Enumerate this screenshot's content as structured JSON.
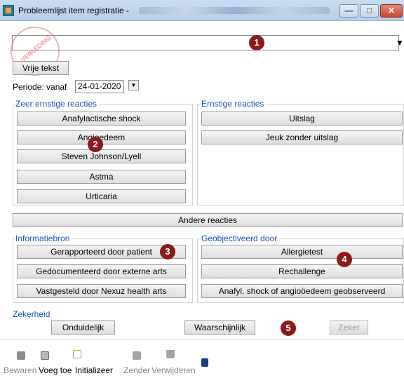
{
  "window": {
    "title": "Probleemlijst item registratie -",
    "minimize_label": "—",
    "maximize_label": "□",
    "close_label": "✕"
  },
  "search": {
    "value": "",
    "dropdown_label": "▼"
  },
  "stamp": {
    "text": "VERLEDING"
  },
  "markers": [
    "1",
    "2",
    "3",
    "4",
    "5"
  ],
  "free_text_button": "Vrije tekst",
  "period": {
    "label": "Periode: vanaf",
    "date": "24-01-2020",
    "picker_label": "▼"
  },
  "very_severe": {
    "title": "Zeer ernstige reacties",
    "items": [
      "Anafylactische shock",
      "Angioedeem",
      "Steven Johnson/Lyell",
      "Astma",
      "Urticaria"
    ]
  },
  "severe": {
    "title": "Ernstige reacties",
    "items": [
      "Uitslag",
      "Jeuk zonder uitslag"
    ]
  },
  "other_reactions_button": "Andere reacties",
  "information_source": {
    "title": "Informatiebron",
    "items": [
      "Gerapporteerd door patient",
      "Gedocumenteerd door externe arts",
      "Vastgesteld door Nexuz health arts"
    ]
  },
  "objectified_by": {
    "title": "Geobjectiveerd door",
    "items": [
      "Allergietest",
      "Rechallenge",
      "Anafyl. shock of angioöedeem geobserveerd"
    ]
  },
  "certainty": {
    "title": "Zekerheid",
    "items": [
      "Onduidelijk",
      "Waarschijnlijk",
      "Zeker"
    ]
  },
  "toolbar": {
    "save": "Bewaren",
    "add": "Voeg toe",
    "initialize": "Initializeer",
    "send": "Zender",
    "delete": "Verwijderen"
  },
  "colors": {
    "group_title": "#1a4fc4",
    "marker": "#8c1a1a",
    "titlebar": "#c9dcf2"
  }
}
